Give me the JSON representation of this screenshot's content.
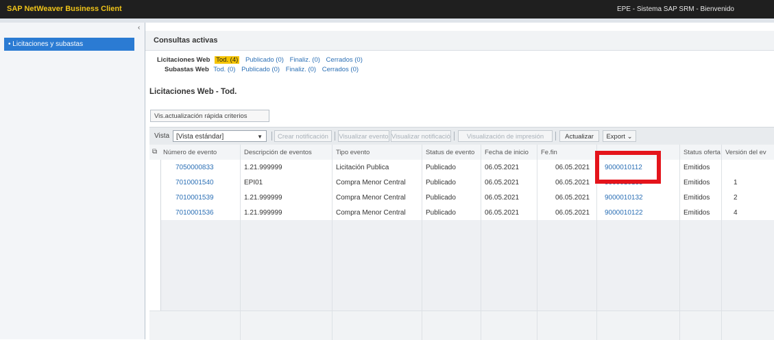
{
  "app": {
    "title": "SAP NetWeaver Business Client",
    "welcome": "EPE - Sistema SAP SRM - Bienvenido"
  },
  "sidebar": {
    "collapse_glyph": "‹",
    "items": [
      {
        "label": "• Licitaciones y subastas",
        "selected": true
      }
    ]
  },
  "panel": {
    "title": "Consultas activas"
  },
  "filters": {
    "licitaciones": {
      "label": "Licitaciones Web",
      "options": [
        "Tod. (4)",
        "Publicado (0)",
        "Finaliz. (0)",
        "Cerrados (0)"
      ],
      "selected": 0
    },
    "subastas": {
      "label": "Subastas Web",
      "options": [
        "Tod. (0)",
        "Publicado (0)",
        "Finaliz. (0)",
        "Cerrados (0)"
      ]
    }
  },
  "section_title": "Licitaciones Web - Tod.",
  "quick_criteria_button": "Vis.actualización rápida criterios",
  "toolbar": {
    "vista_label": "Vista",
    "vista_value": "[Vista estándar]",
    "buttons": {
      "crear": "Crear notificación",
      "visualizar_evento": "Visualizar evento",
      "visualizar_notif": "Visualizar notificación",
      "vista_impresion": "Visualización de impresión",
      "actualizar": "Actualizar",
      "export": "Export ⌄"
    }
  },
  "table": {
    "columns": [
      "Número de evento",
      "Descripción de eventos",
      "Tipo evento",
      "Status de evento",
      "Fecha de inicio",
      "Fe.fin",
      "",
      "Status oferta",
      "Versión del ev"
    ],
    "rows": [
      {
        "numero": "7050000833",
        "descripcion": "1.21.999999",
        "tipo": "Licitación Publica",
        "status": "Publicado",
        "inicio": "06.05.2021",
        "fin": "06.05.2021",
        "oferta_num": "9000010112",
        "status_oferta": "Emitidos",
        "version": ""
      },
      {
        "numero": "7010001540",
        "descripcion": "EPI01",
        "tipo": "Compra Menor Central",
        "status": "Publicado",
        "inicio": "06.05.2021",
        "fin": "06.05.2021",
        "oferta_num": "9000010135",
        "status_oferta": "Emitidos",
        "version": "1"
      },
      {
        "numero": "7010001539",
        "descripcion": "1.21.999999",
        "tipo": "Compra Menor Central",
        "status": "Publicado",
        "inicio": "06.05.2021",
        "fin": "06.05.2021",
        "oferta_num": "9000010132",
        "status_oferta": "Emitidos",
        "version": "2"
      },
      {
        "numero": "7010001536",
        "descripcion": "1.21.999999",
        "tipo": "Compra Menor Central",
        "status": "Publicado",
        "inicio": "06.05.2021",
        "fin": "06.05.2021",
        "oferta_num": "9000010122",
        "status_oferta": "Emitidos",
        "version": "4"
      }
    ],
    "empty_rows": 6
  },
  "colors": {
    "topbar": "#1f1f1f",
    "title_gold": "#f0c419",
    "sidebar_selected": "#2b7bd3",
    "link": "#2b6fb5",
    "filter_selected": "#f5c400",
    "highlight": "#e4141b"
  },
  "icons": {
    "row_selector": "table-settings-icon"
  }
}
